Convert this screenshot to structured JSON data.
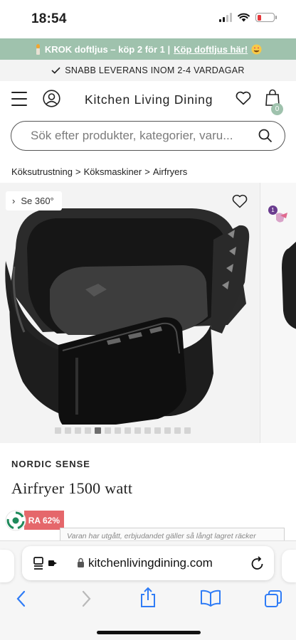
{
  "status_bar": {
    "time": "18:54"
  },
  "promo": {
    "text": "KROK doftljus – köp 2 för 1 | ",
    "link": "Köp doftljus här!",
    "bg_color": "#9fc2ad"
  },
  "delivery": {
    "text": "SNABB LEVERANS INOM 2-4 VARDAGAR"
  },
  "header": {
    "logo": "Kitchen Living Dining",
    "cart_count": "0"
  },
  "search": {
    "placeholder": "Sök efter produkter, kategorier, varu..."
  },
  "breadcrumb": {
    "items": [
      "Köksutrustning",
      "Köksmaskiner",
      "Airfryers"
    ],
    "separator": ">"
  },
  "gallery": {
    "see360_label": "Se 360°",
    "next_badge": "1",
    "slide_count": 14,
    "active_slide": 4
  },
  "product": {
    "brand": "NORDIC SENSE",
    "title": "Airfryer 1500 watt",
    "save_badge": "RA 62%",
    "stock_note": "Varan har utgått, erbjudandet gäller så långt lagret räcker"
  },
  "safari": {
    "url": "kitchenlivingdining.com"
  },
  "colors": {
    "accent": "#9fc2ad",
    "sale": "#e5676b",
    "link_blue": "#2f7cf6"
  }
}
